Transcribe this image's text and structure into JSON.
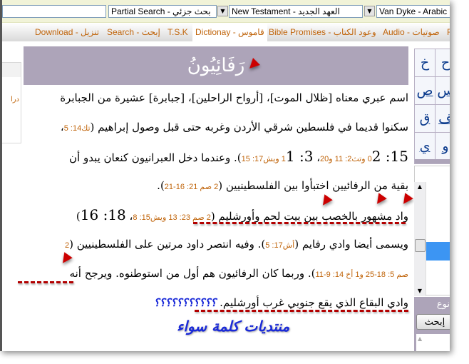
{
  "toolbar": {
    "search_input": "",
    "search_mode": "Partial Search - بحث جزئي",
    "testament": "New Testament - العهد الجديد",
    "version": "Van Dyke - Arabic",
    "dropdown_glyph": "▼"
  },
  "nav": {
    "tabs": [
      {
        "label": "Download - تنزيل",
        "active": false
      },
      {
        "label": "Search - إبحث",
        "active": false
      },
      {
        "label": "T.S.K",
        "active": false
      },
      {
        "label": "Dictionay - قاموس",
        "active": true
      },
      {
        "label": "Bible Promises - وعود الكتاب",
        "active": false
      },
      {
        "label": "Audio - صوتيات",
        "active": false
      },
      {
        "label": "Re",
        "active": false
      }
    ]
  },
  "left_panel": {
    "link": "درا"
  },
  "entry": {
    "title": "رَفَائِيُونُ",
    "lines": [
      [
        {
          "t": "اسم عبري معناه [ظلال الموت]، [أرواح الراحلين]، [جبابرة] عشيرة من الجبابرة"
        }
      ],
      [
        {
          "t": "سكنوا قديما في فلسطين شرقي الأردن وغربه حتى قبل وصول إبراهيم ("
        },
        {
          "r": "تك14: 5"
        },
        {
          "t": "،"
        }
      ],
      [
        {
          "b": "15: "
        },
        {
          "r": "0"
        },
        {
          "b": "2"
        },
        {
          "r": " وتث2: 11 و20"
        },
        {
          "t": "، "
        },
        {
          "b": "3: "
        },
        {
          "r": "1"
        },
        {
          "b": "1"
        },
        {
          "r": " ويش17: 15"
        },
        {
          "t": "). وعندما دخل العبرانيون كنعان يبدو أن"
        }
      ],
      [
        {
          "t": "بقية من الرفائيين اختبأوا بين الفلسطينيين ("
        },
        {
          "r": "2 صم 21: 16-21"
        },
        {
          "t": ")."
        }
      ],
      [
        {
          "t": "واد مشهور بالخصب بين بيت لحم وأورشليم ("
        },
        {
          "r": "2 صم 23: 13 ويش15: 8"
        },
        {
          "t": "، "
        },
        {
          "b": "18: 16"
        },
        {
          "t": ")"
        }
      ],
      [
        {
          "t": "ويسمى أيضا وادي رفايم ("
        },
        {
          "r": "أش17: 5"
        },
        {
          "t": "). وفيه انتصر داود مرتين على الفلسطينيين ("
        },
        {
          "r": "2"
        }
      ],
      [
        {
          "r": "صم 5: 18-25 و1 أخ 14: 9-11"
        },
        {
          "t": "). وربما كان الرفائيون هم أول من استوطنوه. ويرجح أنه"
        }
      ],
      [
        {
          "t": "وادي البقاع الذي يقع جنوبي غرب أورشليم. "
        },
        {
          "q": "؟؟؟؟؟؟؟؟؟؟؟"
        }
      ]
    ],
    "signature": "منتديات كلمة سواء"
  },
  "letters": {
    "rows": [
      [
        "خ",
        "ح"
      ],
      [
        "ص",
        "س"
      ],
      [
        "ق",
        "ف"
      ],
      [
        "ي",
        "و"
      ]
    ]
  },
  "side_search": {
    "label": "نوع",
    "button": "إبحث"
  },
  "colors": {
    "accent": "#c0640a",
    "header_bg": "#ada4b9",
    "link_blue": "#0a3a8c",
    "annotation_red": "#b30000",
    "signature_blue": "#1a2ad8",
    "selection_blue": "#3c95f3"
  }
}
